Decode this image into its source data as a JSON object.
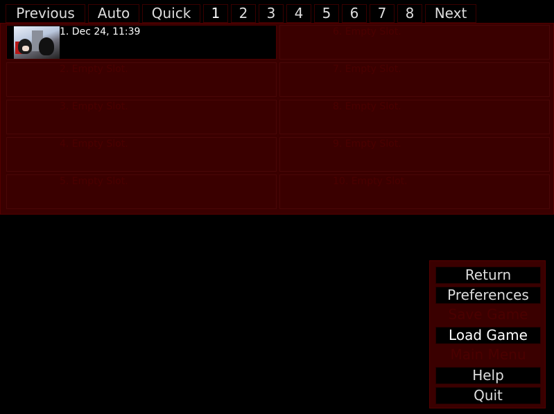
{
  "nav": {
    "previous": "Previous",
    "auto": "Auto",
    "quick": "Quick",
    "pages": [
      "1",
      "2",
      "3",
      "4",
      "5",
      "6",
      "7",
      "8"
    ],
    "selected_page": "1",
    "next": "Next"
  },
  "slots": [
    "1. Dec 24, 11:39",
    "2. Empty Slot.",
    "3. Empty Slot.",
    "4. Empty Slot.",
    "5. Empty Slot.",
    "6. Empty Slot.",
    "7. Empty Slot.",
    "8. Empty Slot.",
    "9. Empty Slot.",
    "10. Empty Slot."
  ],
  "menu": {
    "return": "Return",
    "preferences": "Preferences",
    "save_game": "Save Game",
    "load_game": "Load Game",
    "main_menu": "Main Menu",
    "help": "Help",
    "quit": "Quit"
  },
  "colors": {
    "panel": "#3a0000",
    "disabled_text": "#4a0000",
    "text": "#dedede"
  }
}
